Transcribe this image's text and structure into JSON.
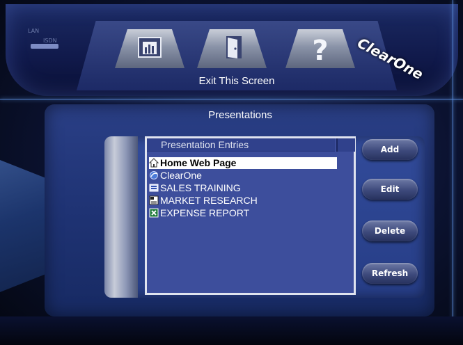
{
  "header": {
    "lan_label": "LAN",
    "isdn_label": "ISDN",
    "logo_text": "ClearOne",
    "exit_label": "Exit This Screen",
    "tabs": [
      {
        "icon": "chart-icon"
      },
      {
        "icon": "exit-door-icon"
      },
      {
        "icon": "help-question-icon"
      }
    ]
  },
  "panel": {
    "title": "Presentations",
    "list_header": "Presentation Entries",
    "entries": [
      {
        "label": "Home Web Page",
        "icon": "home-icon",
        "selected": true
      },
      {
        "label": "ClearOne",
        "icon": "browser-icon",
        "selected": false
      },
      {
        "label": "SALES TRAINING",
        "icon": "presentation-icon",
        "selected": false
      },
      {
        "label": "MARKET RESEARCH",
        "icon": "document-icon",
        "selected": false
      },
      {
        "label": "EXPENSE REPORT",
        "icon": "spreadsheet-icon",
        "selected": false
      }
    ]
  },
  "buttons": {
    "add": "Add",
    "edit": "Edit",
    "delete": "Delete",
    "refresh": "Refresh"
  },
  "colors": {
    "accent": "#2a3f86",
    "selection": "#ffffff",
    "list_bg": "#3d4e9c"
  }
}
